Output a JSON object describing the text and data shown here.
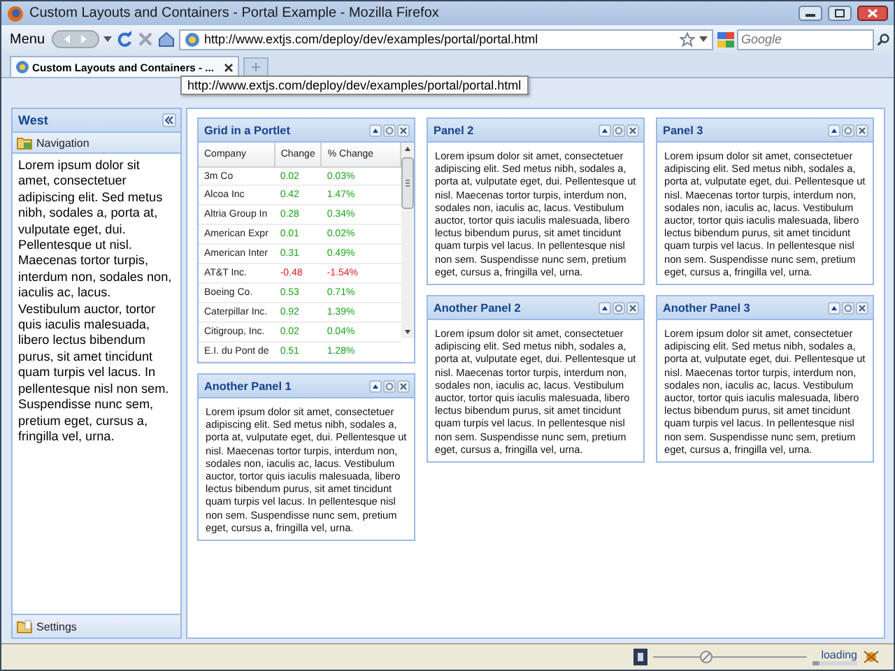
{
  "window": {
    "title": "Custom Layouts and Containers - Portal Example - Mozilla Firefox"
  },
  "navbar": {
    "menu": "Menu",
    "url": "http://www.extjs.com/deploy/dev/examples/portal/portal.html",
    "search": {
      "placeholder": "Google"
    }
  },
  "tabs": [
    {
      "label": "Custom Layouts and Containers - ...",
      "selected": true
    }
  ],
  "tooltip": "http://www.extjs.com/deploy/dev/examples/portal/portal.html",
  "west": {
    "title": "West",
    "sections": [
      {
        "title": "Navigation",
        "expanded": true,
        "text": "Lorem ipsum dolor sit amet, consectetuer adipiscing elit. Sed metus nibh, sodales a, porta at, vulputate eget, dui. Pellentesque ut nisl. Maecenas tortor turpis, interdum non, sodales non, iaculis ac, lacus. Vestibulum auctor, tortor quis iaculis malesuada, libero lectus bibendum purus, sit amet tincidunt quam turpis vel lacus. In pellentesque nisl non sem. Suspendisse nunc sem, pretium eget, cursus a, fringilla vel, urna."
      },
      {
        "title": "Settings",
        "expanded": false
      }
    ]
  },
  "columns": [
    {
      "panels": [
        {
          "kind": "grid",
          "title": "Grid in a Portlet",
          "columns": [
            "Company",
            "Change",
            "% Change"
          ],
          "rows": [
            {
              "company": "3m Co",
              "change": "0.02",
              "pct": "0.03%",
              "negative": false
            },
            {
              "company": "Alcoa Inc",
              "change": "0.42",
              "pct": "1.47%",
              "negative": false
            },
            {
              "company": "Altria Group In",
              "change": "0.28",
              "pct": "0.34%",
              "negative": false
            },
            {
              "company": "American Expr",
              "change": "0.01",
              "pct": "0.02%",
              "negative": false
            },
            {
              "company": "American Inter",
              "change": "0.31",
              "pct": "0.49%",
              "negative": false
            },
            {
              "company": "AT&T Inc.",
              "change": "-0.48",
              "pct": "-1.54%",
              "negative": true
            },
            {
              "company": "Boeing Co.",
              "change": "0.53",
              "pct": "0.71%",
              "negative": false
            },
            {
              "company": "Caterpillar Inc.",
              "change": "0.92",
              "pct": "1.39%",
              "negative": false
            },
            {
              "company": "Citigroup, Inc.",
              "change": "0.02",
              "pct": "0.04%",
              "negative": false
            },
            {
              "company": "E.I. du Pont de",
              "change": "0.51",
              "pct": "1.28%",
              "negative": false
            }
          ]
        },
        {
          "kind": "text",
          "title": "Another Panel 1",
          "text": "Lorem ipsum dolor sit amet, consectetuer adipiscing elit. Sed metus nibh, sodales a, porta at, vulputate eget, dui. Pellentesque ut nisl. Maecenas tortor turpis, interdum non, sodales non, iaculis ac, lacus. Vestibulum auctor, tortor quis iaculis malesuada, libero lectus bibendum purus, sit amet tincidunt quam turpis vel lacus. In pellentesque nisl non sem. Suspendisse nunc sem, pretium eget, cursus a, fringilla vel, urna."
        }
      ]
    },
    {
      "panels": [
        {
          "kind": "text",
          "title": "Panel 2",
          "text": "Lorem ipsum dolor sit amet, consectetuer adipiscing elit. Sed metus nibh, sodales a, porta at, vulputate eget, dui. Pellentesque ut nisl. Maecenas tortor turpis, interdum non, sodales non, iaculis ac, lacus. Vestibulum auctor, tortor quis iaculis malesuada, libero lectus bibendum purus, sit amet tincidunt quam turpis vel lacus. In pellentesque nisl non sem. Suspendisse nunc sem, pretium eget, cursus a, fringilla vel, urna."
        },
        {
          "kind": "text",
          "title": "Another Panel 2",
          "text": "Lorem ipsum dolor sit amet, consectetuer adipiscing elit. Sed metus nibh, sodales a, porta at, vulputate eget, dui. Pellentesque ut nisl. Maecenas tortor turpis, interdum non, sodales non, iaculis ac, lacus. Vestibulum auctor, tortor quis iaculis malesuada, libero lectus bibendum purus, sit amet tincidunt quam turpis vel lacus. In pellentesque nisl non sem. Suspendisse nunc sem, pretium eget, cursus a, fringilla vel, urna."
        }
      ]
    },
    {
      "panels": [
        {
          "kind": "text",
          "title": "Panel 3",
          "text": "Lorem ipsum dolor sit amet, consectetuer adipiscing elit. Sed metus nibh, sodales a, porta at, vulputate eget, dui. Pellentesque ut nisl. Maecenas tortor turpis, interdum non, sodales non, iaculis ac, lacus. Vestibulum auctor, tortor quis iaculis malesuada, libero lectus bibendum purus, sit amet tincidunt quam turpis vel lacus. In pellentesque nisl non sem. Suspendisse nunc sem, pretium eget, cursus a, fringilla vel, urna."
        },
        {
          "kind": "text",
          "title": "Another Panel 3",
          "text": "Lorem ipsum dolor sit amet, consectetuer adipiscing elit. Sed metus nibh, sodales a, porta at, vulputate eget, dui. Pellentesque ut nisl. Maecenas tortor turpis, interdum non, sodales non, iaculis ac, lacus. Vestibulum auctor, tortor quis iaculis malesuada, libero lectus bibendum purus, sit amet tincidunt quam turpis vel lacus. In pellentesque nisl non sem. Suspendisse nunc sem, pretium eget, cursus a, fringilla vel, urna."
        }
      ]
    }
  ],
  "status_bar": {
    "text": "loading",
    "level": 0.15
  }
}
